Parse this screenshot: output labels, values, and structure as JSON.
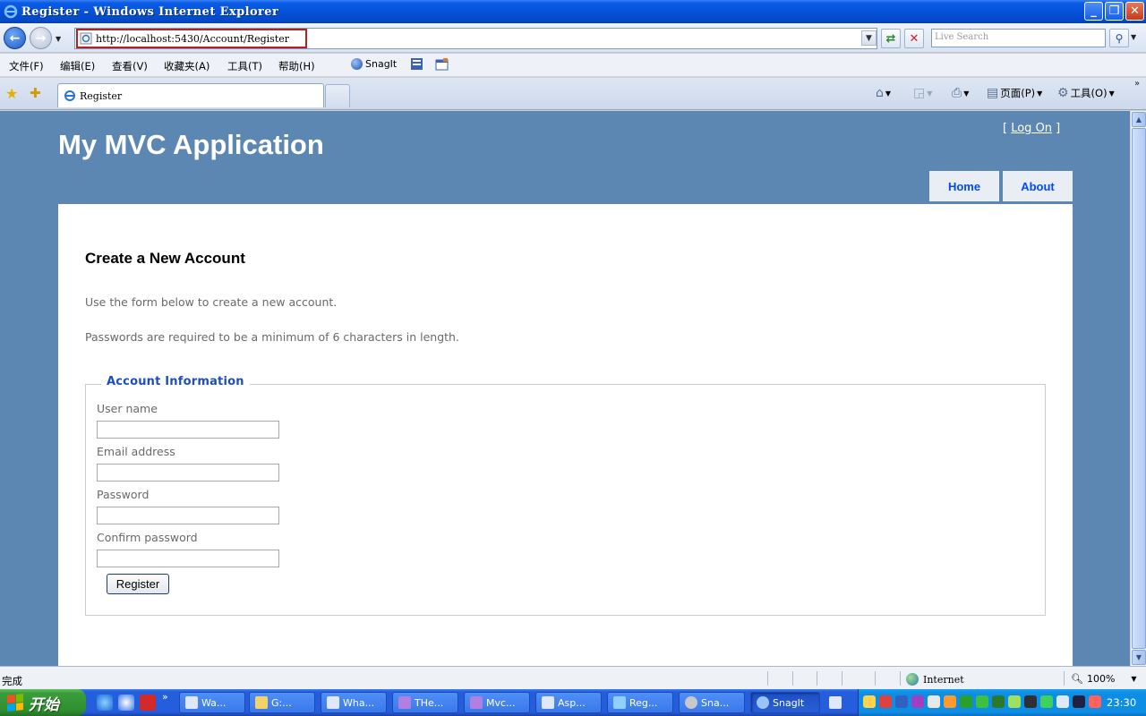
{
  "window": {
    "title": "Register - Windows Internet Explorer"
  },
  "address_bar": {
    "url": "http://localhost:5430/Account/Register"
  },
  "search": {
    "placeholder": "Live Search"
  },
  "menu": {
    "items": [
      "文件(F)",
      "编辑(E)",
      "查看(V)",
      "收藏夹(A)",
      "工具(T)",
      "帮助(H)"
    ],
    "snagit": "SnagIt"
  },
  "tab": {
    "title": "Register"
  },
  "command_bar": {
    "page": "页面(P)",
    "tools": "工具(O)"
  },
  "page": {
    "site_title": "My MVC Application",
    "logon_link": "Log On",
    "nav": {
      "home": "Home",
      "about": "About"
    },
    "heading": "Create a New Account",
    "intro": "Use the form below to create a new account.",
    "password_note": "Passwords are required to be a minimum of 6 characters in length.",
    "form": {
      "legend": "Account Information",
      "username_label": "User name",
      "email_label": "Email address",
      "password_label": "Password",
      "confirm_label": "Confirm password",
      "submit": "Register"
    }
  },
  "status_bar": {
    "text": "完成",
    "zone": "Internet",
    "zoom": "100%"
  },
  "taskbar": {
    "start": "开始",
    "buttons": [
      "Wa...",
      "G:...",
      "Wha...",
      "THe...",
      "Mvc...",
      "Asp...",
      "Reg...",
      "Sna...",
      "SnagIt"
    ],
    "clock": "23:30"
  },
  "colors": {
    "page_bg": "#5c87b2",
    "nav_link": "#034af3",
    "legend": "#1c50b8",
    "titlebar": "#0552d8"
  }
}
